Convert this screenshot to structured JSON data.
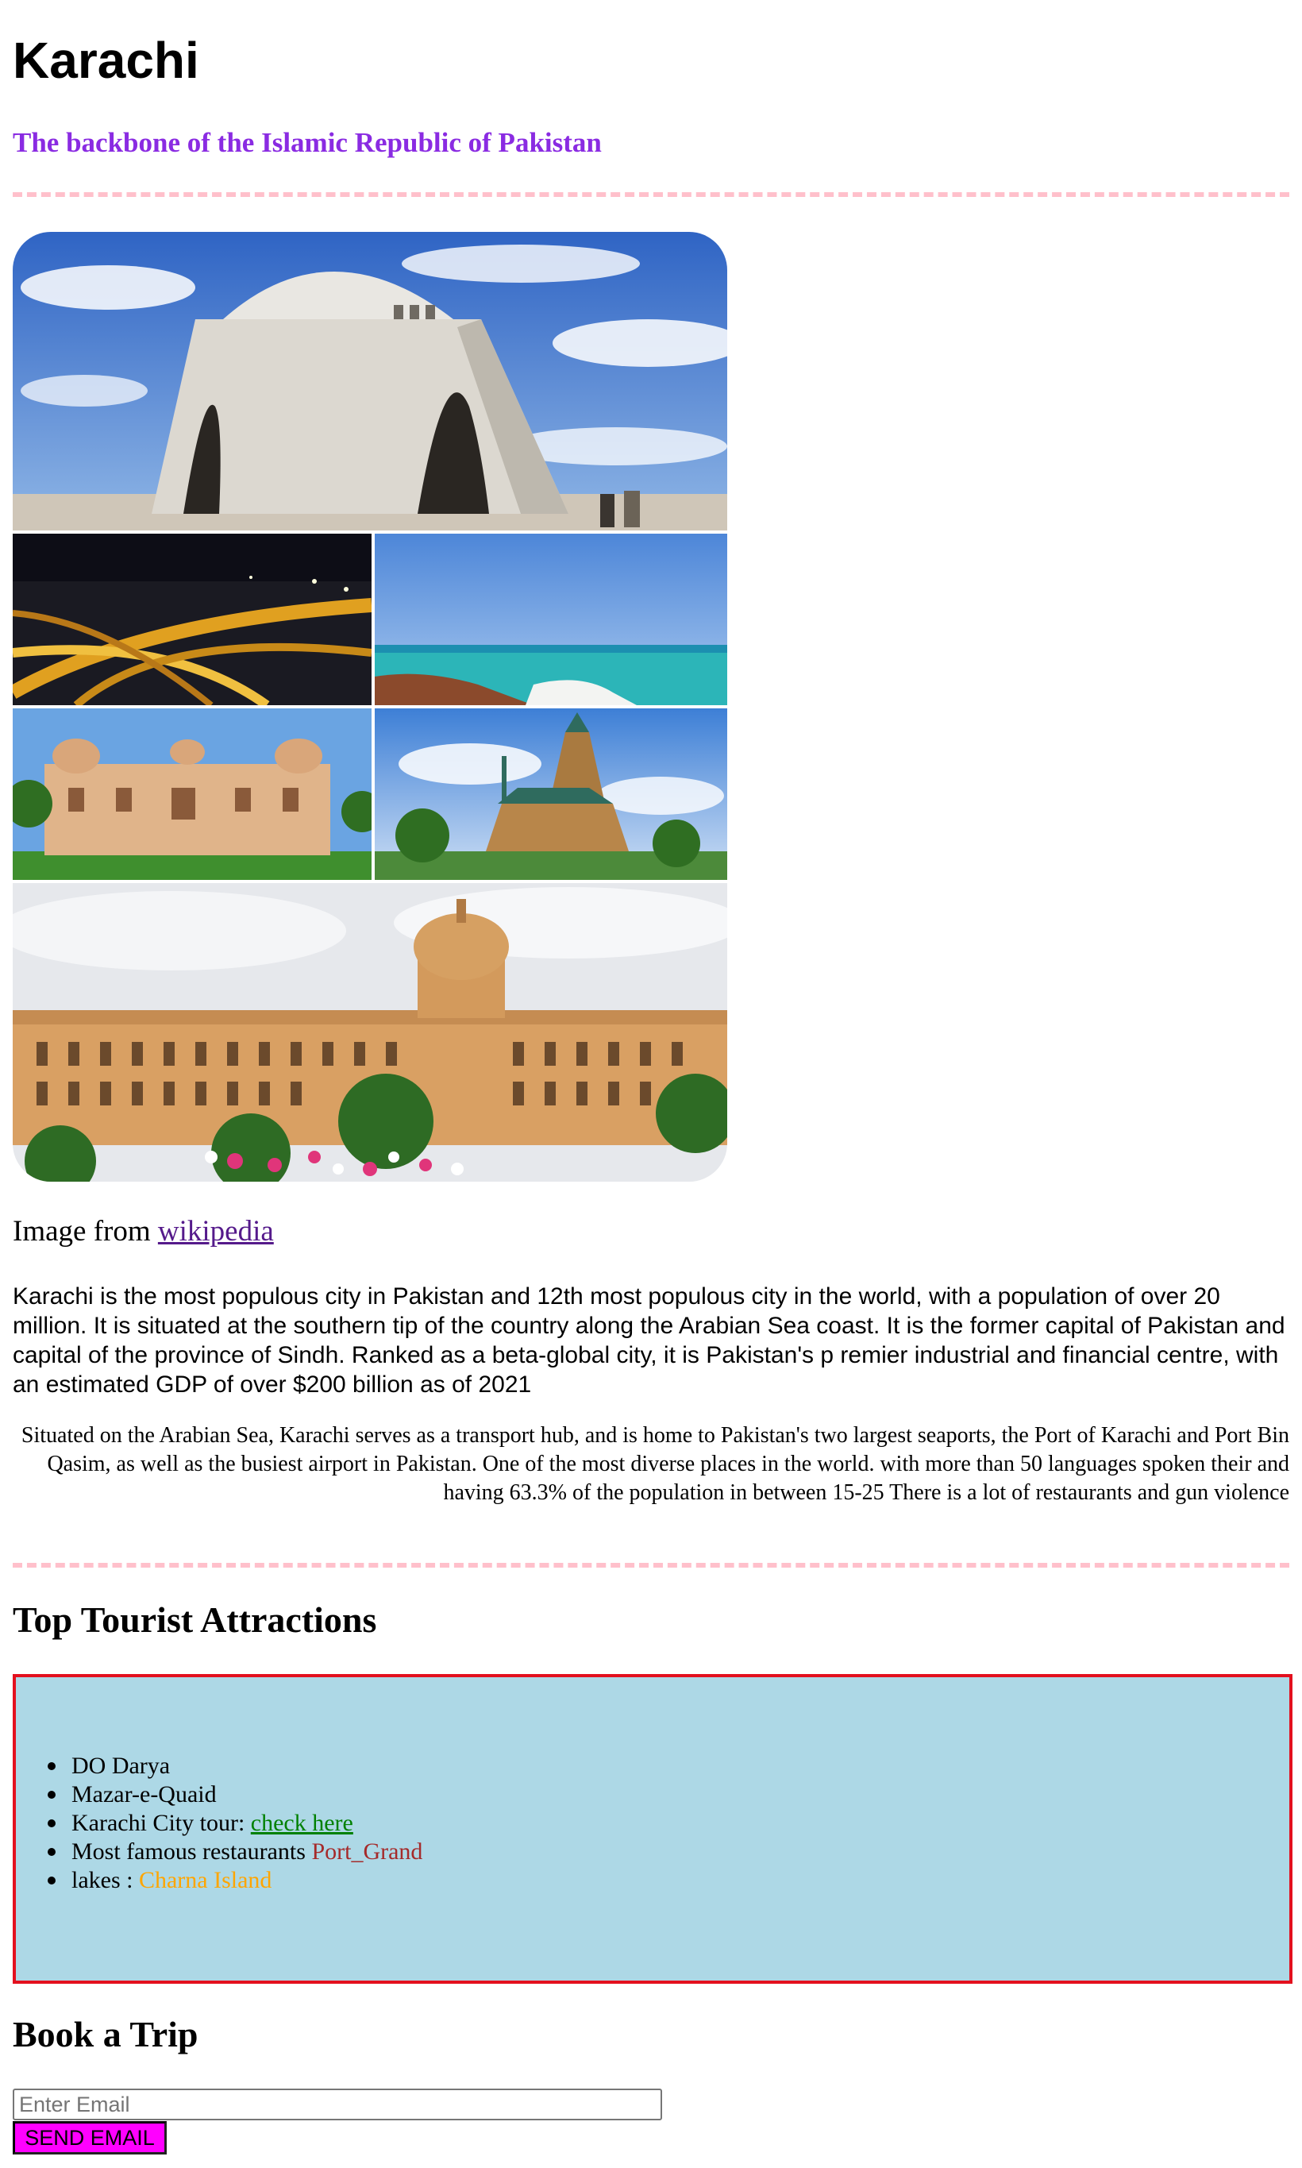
{
  "header": {
    "title": "Karachi",
    "subtitle": "The backbone of the Islamic Republic of Pakistan"
  },
  "collage": {
    "images": [
      "mazar-e-quaid",
      "karachi-highway-night",
      "karachi-beach",
      "mohatta-palace",
      "frere-hall",
      "karachi-port-trust-building"
    ]
  },
  "credit": {
    "prefix": "Image from ",
    "link_label": "wikipedia"
  },
  "intro": {
    "paragraph1": "Karachi is the most populous city in Pakistan and 12th most populous city in the world, with a population of over 20 million. It is situated at the southern tip of the country along the Arabian Sea coast. It is the former capital of Pakistan and capital of the province of Sindh. Ranked as a beta-global city, it is Pakistan's p remier industrial and financial centre, with an estimated GDP of over $200 billion as of 2021",
    "paragraph2": "Situated on the Arabian Sea, Karachi serves as a transport hub, and is home to Pakistan's two largest seaports, the Port of Karachi and Port Bin Qasim, as well as the busiest airport in Pakistan. One of the most diverse places in the world. with more than 50 languages spoken their and having 63.3% of the population in between 15-25 There is a lot of restaurants and gun violence"
  },
  "attractions": {
    "heading": "Top Tourist Attractions",
    "items": [
      {
        "text": "DO Darya"
      },
      {
        "text": "Mazar-e-Quaid"
      },
      {
        "text": "Karachi City tour: ",
        "link": "check here"
      },
      {
        "text": "Most famous restaurants ",
        "highlight": "Port_Grand"
      },
      {
        "text": "lakes : ",
        "highlight": "Charna Island"
      }
    ]
  },
  "booking": {
    "heading": "Book a Trip",
    "email_placeholder": "Enter Email",
    "email_value": "",
    "send_label": "SEND EMAIL"
  },
  "colors": {
    "subtitle": "#8a2be2",
    "divider": "#ffc0cb",
    "attractions_bg": "#add8e6",
    "attractions_border": "#e3101e",
    "link_green": "#008000",
    "port_grand": "#a52a2a",
    "charna_island": "#ffa500",
    "button_bg": "#ff00ff"
  }
}
